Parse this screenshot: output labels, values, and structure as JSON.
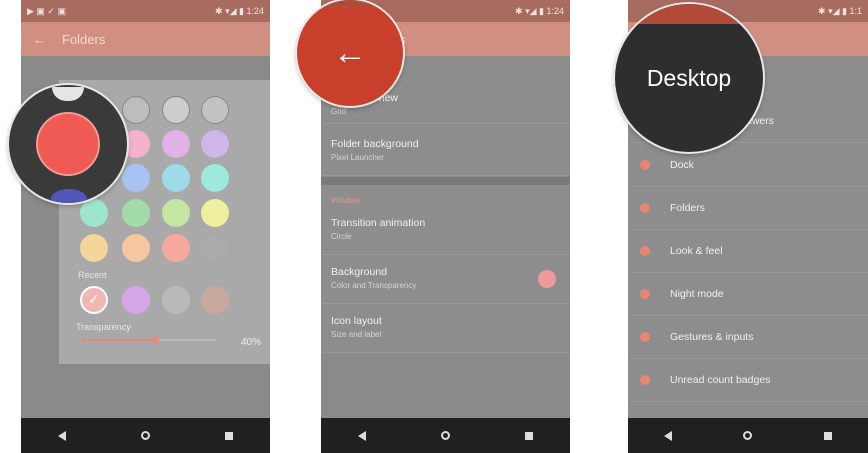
{
  "phone1": {
    "status": {
      "left_icons": "▶ ▣ ✓ ▣",
      "right": "✱ ▾◢ ▮ 1:24"
    },
    "title": "Folders",
    "palette": {
      "recent_label": "Recent",
      "transparency_label": "Transparency",
      "transparency_value": "40%",
      "transparency_level": 0.55,
      "rows": [
        [
          "#f2b7b3",
          "#bdbdbd",
          "#cccccc",
          "#c2c2c2"
        ],
        [
          "#f08c86",
          "#f4b3cd",
          "#e2b1e5",
          "#ceb6ea"
        ],
        [
          "#7f7fd9",
          "#a7c2f3",
          "#9edbe8",
          "#9ee8de"
        ],
        [
          "#9ee5cf",
          "#a3dca9",
          "#c3e6a2",
          "#f0ef9e"
        ],
        [
          "#f5d69a",
          "#f7c7a0",
          "#f5a99e",
          "#aaaaaa"
        ]
      ],
      "recent": [
        "#f2b7b3",
        "#d6a4e8",
        "#b9b9b9",
        "#c9a89e"
      ]
    },
    "magnifier_color": "#ef5a54"
  },
  "phone2": {
    "status": {
      "right": "✱ ▾◢ ▮ 1:24"
    },
    "title_partial": "s",
    "rows": [
      {
        "title": "view",
        "sub": "Grid"
      },
      {
        "title": "Folder background",
        "sub": "Pixel Launcher"
      },
      {
        "title": "Transition animation",
        "sub": "Circle"
      },
      {
        "title": "Background",
        "sub": "Color and Transparency"
      },
      {
        "title": "Icon layout",
        "sub": "Size and label"
      }
    ],
    "section": "Window",
    "back_color": "#c8402b",
    "bg_swatch": "#ef9a9a"
  },
  "phone3": {
    "status": {
      "right": "✱ ▾◢ ▮ 1:1"
    },
    "magnifier_label": "Desktop",
    "drawers_partial": "awers",
    "items": [
      "Dock",
      "Folders",
      "Look & feel",
      "Night mode",
      "Gestures & inputs",
      "Unread count badges"
    ]
  }
}
